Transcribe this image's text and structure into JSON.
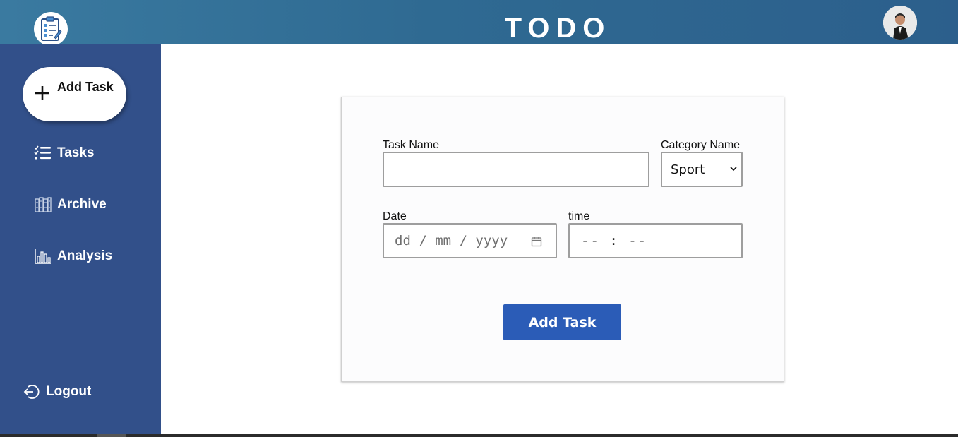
{
  "header": {
    "title": "TODO",
    "logo_icon": "clipboard-checklist-icon",
    "avatar_icon": "user-avatar-icon"
  },
  "sidebar": {
    "add_task_label": "Add Task",
    "items": [
      {
        "label": "Tasks",
        "icon": "checklist-icon"
      },
      {
        "label": "Archive",
        "icon": "archive-icon"
      },
      {
        "label": "Analysis",
        "icon": "bar-chart-icon"
      }
    ],
    "logout_label": "Logout",
    "logout_icon": "logout-icon"
  },
  "form": {
    "task_name_label": "Task Name",
    "task_name_value": "",
    "category_label": "Category Name",
    "category_selected": "Sport",
    "date_label": "Date",
    "date_placeholder": "dd / mm / yyyy",
    "time_label": "time",
    "time_placeholder": "-- : --",
    "submit_label": "Add Task"
  },
  "colors": {
    "header": "#2f6a92",
    "sidebar": "#32508a",
    "button": "#2b5cb7"
  }
}
